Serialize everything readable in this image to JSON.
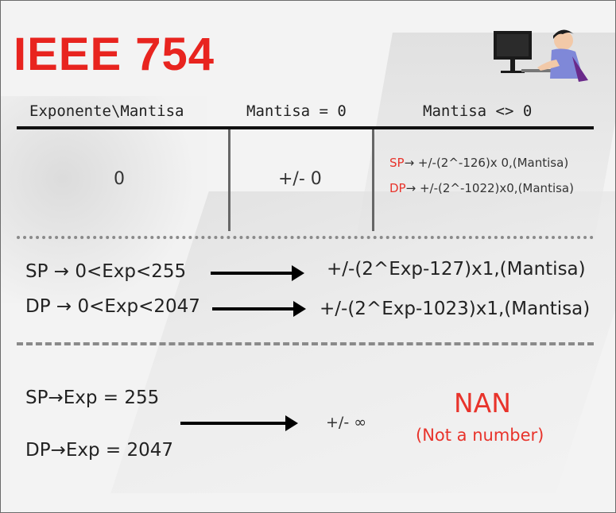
{
  "title": "IEEE 754",
  "table": {
    "headers": [
      "Exponente\\Mantisa",
      "Mantisa = 0",
      "Mantisa <> 0"
    ],
    "row": {
      "exp": "0",
      "mantisa_zero": "+/- 0",
      "sp_tag": "SP",
      "sp_formula": "→ +/-(2^-126)x 0,(Mantisa)",
      "dp_tag": "DP",
      "dp_formula": "→ +/-(2^-1022)x0,(Mantisa)"
    }
  },
  "normal": {
    "sp_label": "SP → 0<Exp<255",
    "sp_formula": "+/-(2^Exp-127)x1,(Mantisa)",
    "dp_label": "DP → 0<Exp<2047",
    "dp_formula": "+/-(2^Exp-1023)x1,(Mantisa)"
  },
  "special": {
    "sp_label": "SP→Exp = 255",
    "dp_label": "DP→Exp = 2047",
    "result": "+/- ∞",
    "nan": "NAN",
    "nan_sub": "(Not a number)"
  },
  "colors": {
    "title": "#e8241f",
    "accent_red": "#e8332b"
  },
  "icons": [
    "person-at-computer-icon",
    "arrow-right-icon"
  ]
}
